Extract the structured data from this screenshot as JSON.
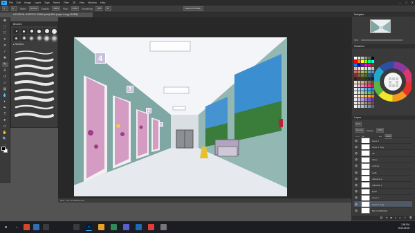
{
  "app": {
    "logo": "Ps"
  },
  "menu": [
    "File",
    "Edit",
    "Image",
    "Layer",
    "Type",
    "Select",
    "Filter",
    "3D",
    "View",
    "Window",
    "Help"
  ],
  "window_controls": [
    "—",
    "□",
    "✕"
  ],
  "options_bar": {
    "mode_label": "Mode:",
    "mode_value": "Normal",
    "opacity_label": "Opacity:",
    "opacity_value": "100%",
    "flow_label": "Flow:",
    "flow_value": "100%",
    "smoothing_label": "Smoothing:",
    "smoothing_value": "10%",
    "subject_button": "Select and Mask..."
  },
  "document_tab": {
    "label": "LOCATION- HOSPITAL THINK.psd @ 50% (Layer 4 copy, RGB/8)"
  },
  "brush_panel": {
    "title": "Brushes",
    "folder": "Sketches"
  },
  "status_bar": {
    "zoom": "50%",
    "doc_info": "Doc: 20.6M/310.4M"
  },
  "navigator": {
    "title": "Navigator",
    "zoom": "50%"
  },
  "swatches": {
    "title": "Swatches"
  },
  "layers_panel": {
    "title": "Layers",
    "kind_label": "Kind",
    "blend_mode": "Normal",
    "opacity_label": "Opacity:",
    "opacity_value": "100%",
    "lock_label": "Lock:",
    "fill_label": "Fill:",
    "fill_value": "100%",
    "layers": [
      {
        "name": "Layer 4",
        "visible": true,
        "selected": false
      },
      {
        "name": "Layer 6 copy",
        "visible": true,
        "selected": false
      },
      {
        "name": "tile",
        "visible": true,
        "selected": false
      },
      {
        "name": "frame",
        "visible": true,
        "selected": false
      },
      {
        "name": "ceilings",
        "visible": true,
        "selected": false
      },
      {
        "name": "walls",
        "visible": true,
        "selected": false
      },
      {
        "name": "reflection 2",
        "visible": true,
        "selected": false
      },
      {
        "name": "reflection 1",
        "visible": true,
        "selected": false
      },
      {
        "name": "lights",
        "visible": true,
        "selected": false
      },
      {
        "name": "Layer 4",
        "visible": true,
        "selected": false
      },
      {
        "name": "Layer 5 copy",
        "visible": true,
        "selected": true
      },
      {
        "name": "BG FLOORGRA",
        "visible": true,
        "selected": false
      }
    ]
  },
  "artwork": {
    "door_numbers": [
      "4",
      "3",
      "2",
      "1"
    ]
  },
  "taskbar": {
    "time": "2:58 PM",
    "date": "2019-09-06"
  },
  "colors": {
    "accent": "#31a8ff",
    "selected_layer": "#505a66"
  }
}
